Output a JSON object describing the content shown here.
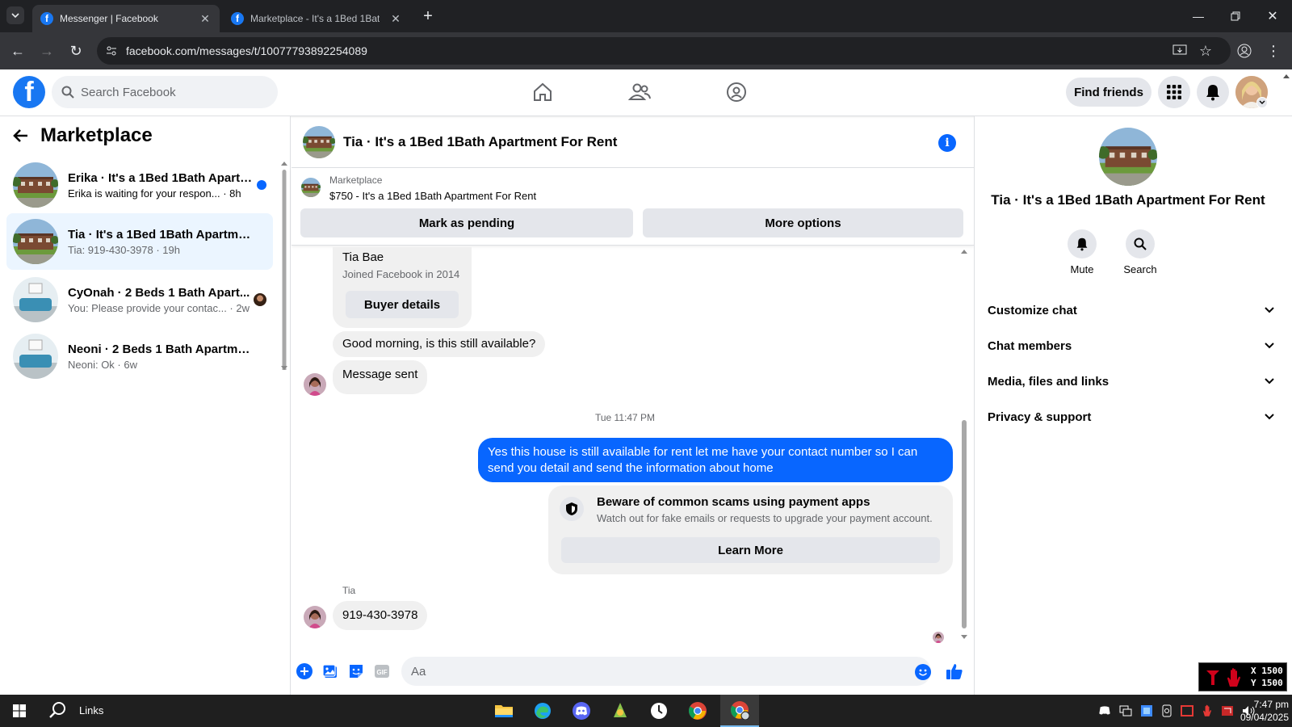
{
  "browser": {
    "tabs": [
      {
        "title": "Messenger | Facebook",
        "active": true
      },
      {
        "title": "Marketplace - It's a 1Bed 1Bath Apartm",
        "active": false
      }
    ],
    "url": "facebook.com/messages/t/10077793892254089"
  },
  "fb_header": {
    "logo": "f",
    "search_placeholder": "Search Facebook",
    "find_friends": "Find friends",
    "nav_icons": [
      "home-icon",
      "friends-icon",
      "groups-icon"
    ]
  },
  "sidebar": {
    "title": "Marketplace",
    "conversations": [
      {
        "name": "Erika · It's a 1Bed 1Bath Apartm...",
        "snippet": "Erika is waiting for your respon... · 8h",
        "unread": true
      },
      {
        "name": "Tia · It's a 1Bed 1Bath Apartment ...",
        "snippet": "Tia: 919-430-3978 · 19h",
        "active": true
      },
      {
        "name": "CyOnah · 2 Beds 1 Bath Apart...",
        "snippet": "You: Please provide your contac... · 2w"
      },
      {
        "name": "Neoni · 2 Beds 1 Bath Apartment...",
        "snippet": "Neoni: Ok · 6w"
      }
    ]
  },
  "chat": {
    "title": "Tia · It's a 1Bed 1Bath Apartment For Rent",
    "marketplace_label": "Marketplace",
    "listing": "$750 - It's a 1Bed 1Bath Apartment For Rent",
    "mark_pending": "Mark as pending",
    "more_options": "More options",
    "buyer_name": "Tia Bae",
    "buyer_joined": "Joined Facebook in 2014",
    "buyer_details": "Buyer details",
    "msg_in_1": "Good morning, is this still available?",
    "msg_in_2": "Message sent",
    "timestamp": "Tue 11:47 PM",
    "msg_out": "Yes this house is still available for rent let me have your contact number so I can send you detail and send the information about home",
    "scam_title": "Beware of common scams using payment apps",
    "scam_text": "Watch out for fake emails or requests to upgrade your payment account.",
    "learn_more": "Learn More",
    "sender_label": "Tia",
    "msg_in_3": "919-430-3978",
    "input_placeholder": "Aa"
  },
  "right_panel": {
    "title": "Tia · It's a 1Bed 1Bath Apartment For Rent",
    "actions": [
      {
        "label": "Mute",
        "icon": "bell-icon"
      },
      {
        "label": "Search",
        "icon": "search-icon"
      }
    ],
    "sections": [
      "Customize chat",
      "Chat members",
      "Media, files and links",
      "Privacy & support"
    ]
  },
  "overlay": {
    "x": "X 1500",
    "y": "Y 1500"
  },
  "taskbar": {
    "search_label": "Links",
    "time": "7:47 pm",
    "date": "09/04/2025"
  },
  "colors": {
    "fb_blue": "#1877f2",
    "messenger_blue": "#0866ff",
    "active_conv": "#ebf5ff"
  }
}
